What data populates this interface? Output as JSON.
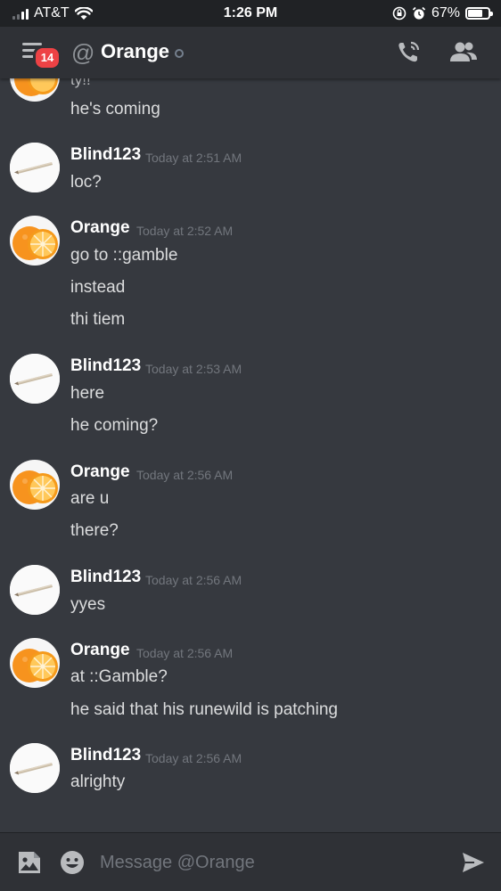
{
  "status_bar": {
    "carrier": "AT&T",
    "time": "1:26 PM",
    "battery": "67%",
    "icons": [
      "signal-icon",
      "wifi-icon",
      "orientation-lock-icon",
      "alarm-icon",
      "battery-icon"
    ]
  },
  "header": {
    "badge_count": "14",
    "at_symbol": "@",
    "title": "Orange",
    "icons": [
      "menu-icon",
      "call-icon",
      "members-icon"
    ]
  },
  "messages": {
    "partial_author_line": "ty!!",
    "partial_lines": [
      "he's coming"
    ],
    "groups": [
      {
        "author": "Blind123",
        "avatar": "wand-avatar",
        "timestamp": "Today at 2:51 AM",
        "lines": [
          "loc?"
        ]
      },
      {
        "author": "Orange",
        "avatar": "orange-avatar",
        "timestamp": "Today at 2:52 AM",
        "lines": [
          "go to ::gamble",
          "instead",
          "thi tiem"
        ]
      },
      {
        "author": "Blind123",
        "avatar": "wand-avatar",
        "timestamp": "Today at 2:53 AM",
        "lines": [
          "here",
          "he coming?"
        ]
      },
      {
        "author": "Orange",
        "avatar": "orange-avatar",
        "timestamp": "Today at 2:56 AM",
        "lines": [
          "are u",
          "there?"
        ]
      },
      {
        "author": "Blind123",
        "avatar": "wand-avatar",
        "timestamp": "Today at 2:56 AM",
        "lines": [
          "yyes"
        ]
      },
      {
        "author": "Orange",
        "avatar": "orange-avatar",
        "timestamp": "Today at 2:56 AM",
        "lines": [
          "at ::Gamble?",
          "he said that his runewild is patching"
        ]
      },
      {
        "author": "Blind123",
        "avatar": "wand-avatar",
        "timestamp": "Today at 2:56 AM",
        "lines": [
          "alrighty"
        ]
      }
    ]
  },
  "composer": {
    "placeholder": "Message @Orange",
    "icons": [
      "image-upload-icon",
      "emoji-icon",
      "send-icon"
    ]
  },
  "colors": {
    "background": "#36393f",
    "header": "#2f3136",
    "status_bar": "#202225",
    "badge": "#ed4245",
    "text": "#dcddde",
    "timestamp": "#72767d"
  }
}
